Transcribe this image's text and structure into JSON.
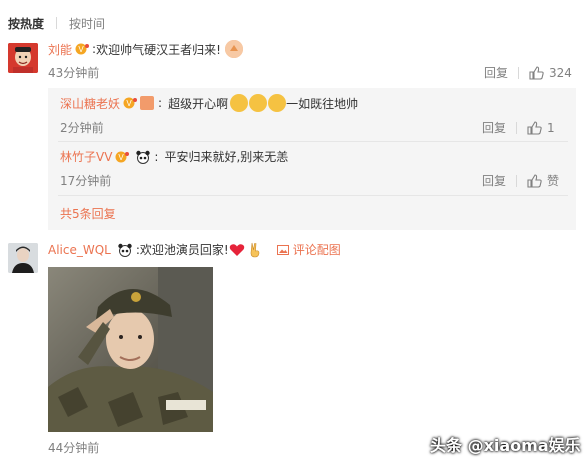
{
  "sort": {
    "hot": "按热度",
    "time": "按时间"
  },
  "comments": [
    {
      "user": "刘能",
      "text": "欢迎帅气硬汉王者归来!",
      "time": "43分钟前",
      "reply": "回复",
      "likes": "324",
      "replies": [
        {
          "user": "深山糖老妖",
          "text": "超级开心啊",
          "text2": "一如既往地帅",
          "time": "2分钟前",
          "reply": "回复",
          "likes": "1"
        },
        {
          "user": "林竹子VV",
          "text": "平安归来就好,别来无恙",
          "time": "17分钟前",
          "reply": "回复",
          "likes": "赞"
        }
      ],
      "more": "共5条回复"
    },
    {
      "user": "Alice_WQL",
      "text": "欢迎池演员回家!",
      "pic_label": "评论配图",
      "time": "44分钟前"
    }
  ],
  "watermark": "头条 @xiaoma娱乐",
  "colors": {
    "accent": "#eb7350",
    "muted": "#808080",
    "subbg": "#f5f5f5"
  }
}
